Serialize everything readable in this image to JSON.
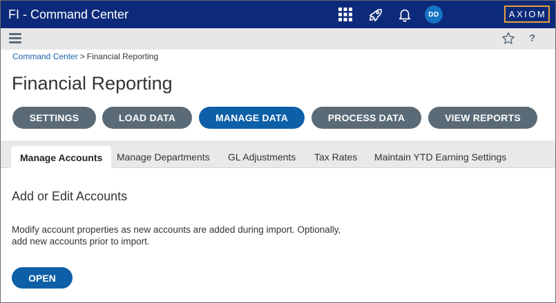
{
  "header": {
    "app_title": "FI - Command Center",
    "avatar_initials": "DD",
    "logo_text": "AXIOM",
    "icons": [
      "apps-grid-icon",
      "rocket-icon",
      "bell-icon"
    ]
  },
  "subbar": {
    "help_label": "?",
    "icons": [
      "menu-icon",
      "star-icon",
      "help-icon"
    ]
  },
  "breadcrumb": {
    "parent": "Command Center",
    "separator": ">",
    "current": "Financial Reporting"
  },
  "page": {
    "title": "Financial Reporting"
  },
  "actions": {
    "settings": "SETTINGS",
    "load_data": "LOAD DATA",
    "manage_data": "MANAGE DATA",
    "process_data": "PROCESS DATA",
    "view_reports": "VIEW REPORTS",
    "active": "MANAGE DATA"
  },
  "tabs": {
    "manage_accounts": "Manage Accounts",
    "manage_departments": "Manage Departments",
    "gl_adjustments": "GL Adjustments",
    "tax_rates": "Tax Rates",
    "maintain_ytd": "Maintain YTD Earning Settings",
    "active": "Manage Accounts"
  },
  "content": {
    "section_title": "Add or Edit Accounts",
    "description_line1": "Modify account properties as new accounts are added during import. Optionally,",
    "description_line2": "add new accounts prior to import.",
    "open_label": "OPEN"
  },
  "colors": {
    "header_bg": "#0d2a7a",
    "button_gray": "#5a6b77",
    "button_active": "#0d60a8",
    "logo_border": "#e8a13a",
    "link": "#1a5fa8"
  }
}
